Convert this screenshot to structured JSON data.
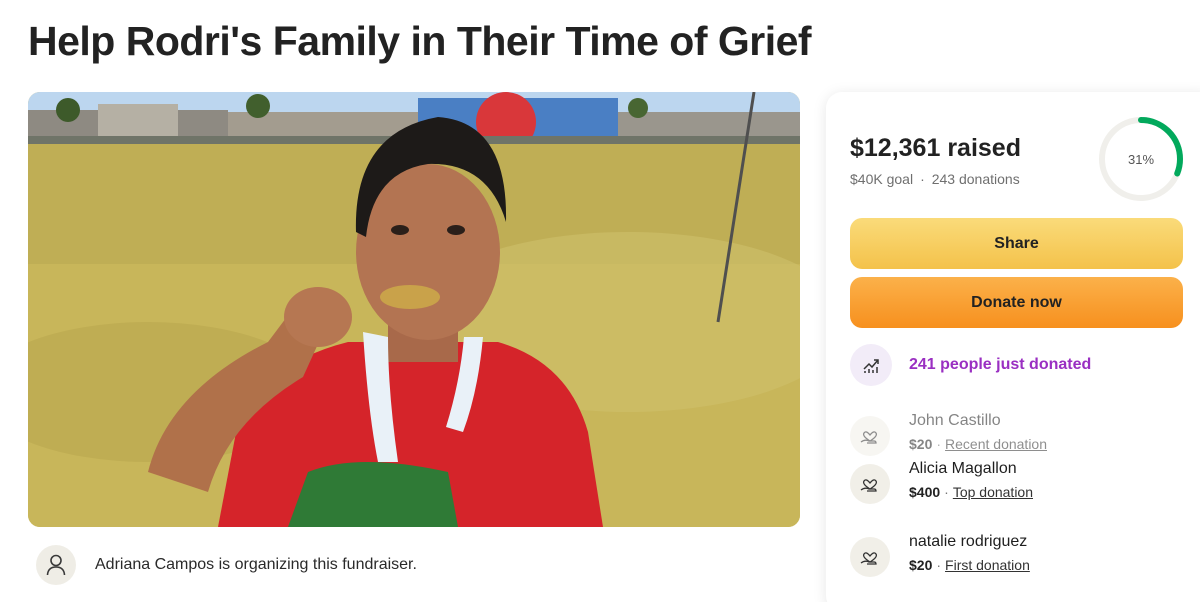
{
  "page": {
    "title": "Help Rodri's Family in Their Time of Grief"
  },
  "hero": {
    "image_icon": "photo-boy-with-medal"
  },
  "organizer": {
    "icon": "user-icon",
    "text": "Adriana Campos is organizing this fundraiser."
  },
  "donation_card": {
    "raised": "$12,361 raised",
    "goal": "$40K goal",
    "separator": "·",
    "donations": "243 donations",
    "progress_label": "31%",
    "progress_fraction": 0.31,
    "share_label": "Share",
    "donate_label": "Donate now",
    "trending_icon": "trending-up-icon",
    "trending_text": "241 people just donated",
    "colors": {
      "accent_green": "#02a95c",
      "trending_purple": "#9a2fc2",
      "share_yellow": "#f4c24a",
      "donate_orange": "#f7901e"
    },
    "donors": [
      {
        "name": "John Castillo",
        "amount": "$20",
        "tag": "Recent donation",
        "icon": "heart-hand-icon"
      },
      {
        "name": "Alicia Magallon",
        "amount": "$400",
        "tag": "Top donation",
        "icon": "heart-hand-icon"
      },
      {
        "name": "natalie rodriguez",
        "amount": "$20",
        "tag": "First donation",
        "icon": "heart-hand-icon"
      }
    ]
  }
}
